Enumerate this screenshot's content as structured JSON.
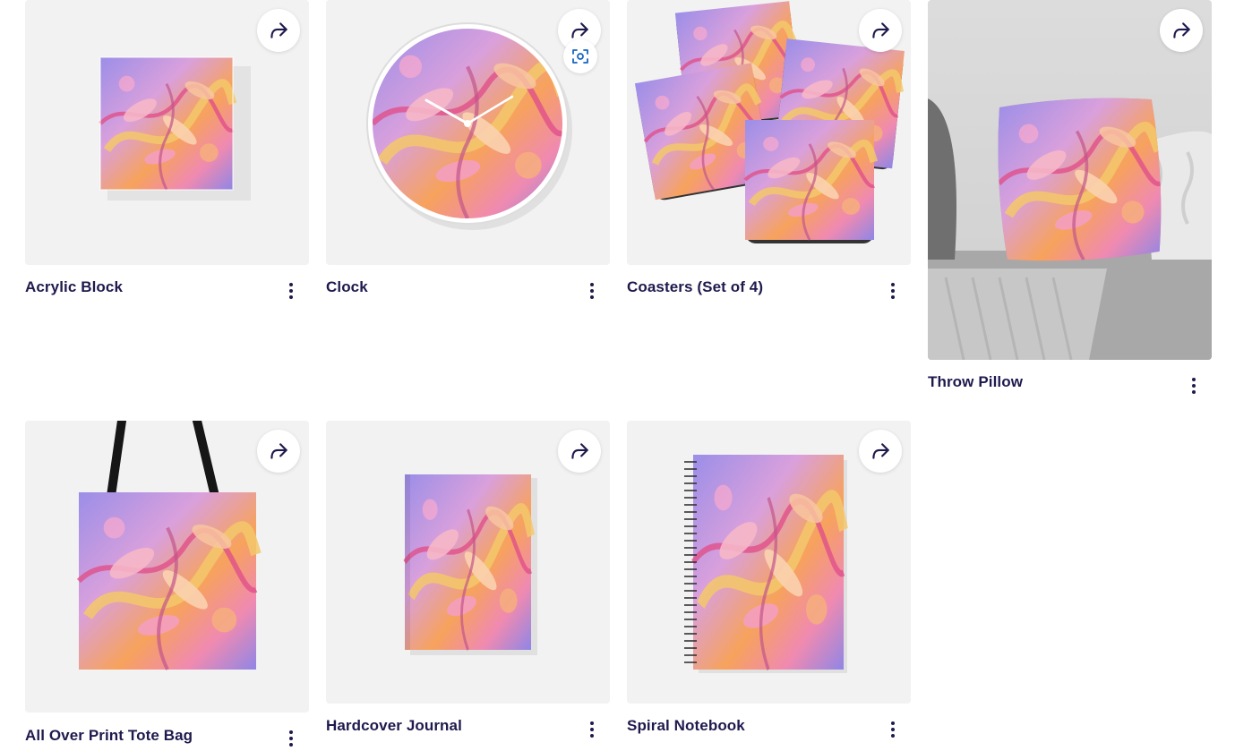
{
  "colors": {
    "title_text": "#1f1a4d",
    "accent": "#1565c0",
    "card_bg": "#f2f2f2",
    "art_purple": "#9b8ee8",
    "art_pink": "#f08ab0",
    "art_orange": "#f7a25c",
    "art_yellow": "#f3c86a"
  },
  "icons": {
    "share": "share-arrow-icon",
    "menu": "kebab-menu-icon",
    "view_in_room": "scan-view-icon"
  },
  "products": [
    {
      "title": "Acrylic Block"
    },
    {
      "title": "Clock"
    },
    {
      "title": "Coasters (Set of 4)"
    },
    {
      "title": "Throw Pillow"
    },
    {
      "title": "All Over Print Tote Bag"
    },
    {
      "title": "Hardcover Journal"
    },
    {
      "title": "Spiral Notebook"
    }
  ]
}
